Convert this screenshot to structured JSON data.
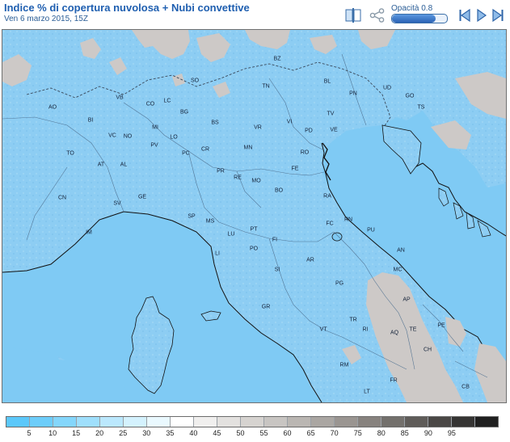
{
  "header": {
    "title": "Indice % di copertura nuvolosa + Nubi convettive",
    "subtitle": "Ven 6 marzo 2015, 15Z"
  },
  "toolbar": {
    "layers_icon": "layers-icon",
    "share_icon": "share-icon",
    "opacity_label": "Opacità 0.8",
    "opacity_value": 0.8,
    "nav_icons": [
      "first-frame-icon",
      "play-icon",
      "last-frame-icon"
    ]
  },
  "map": {
    "sea_color": "#7fcaf4",
    "cloud_color": "#8dcdf3",
    "mountain_color": "#cdc9c7",
    "border_color": "#4d6f8f",
    "coast_color": "#111111",
    "provinces": [
      "BZ",
      "SO",
      "TN",
      "BL",
      "UD",
      "PN",
      "GO",
      "VB",
      "CO",
      "LC",
      "BG",
      "BS",
      "VI",
      "TV",
      "TS",
      "AO",
      "BI",
      "MI",
      "VR",
      "PD",
      "VE",
      "VC",
      "NO",
      "LO",
      "TO",
      "PV",
      "PC",
      "CR",
      "MN",
      "RO",
      "AT",
      "AL",
      "PR",
      "RE",
      "MO",
      "FE",
      "CN",
      "GE",
      "BO",
      "RA",
      "SV",
      "SP",
      "MS",
      "FC",
      "RN",
      "PU",
      "IM",
      "LU",
      "PT",
      "FI",
      "AN",
      "LI",
      "PO",
      "AR",
      "SI",
      "MC",
      "PG",
      "GR",
      "TR",
      "VT",
      "RI",
      "AQ",
      "TE",
      "CH",
      "RM",
      "FR",
      "LT",
      "CB",
      "AP",
      "PE"
    ]
  },
  "legend": {
    "colors": [
      "#5cc8fa",
      "#6dcdfa",
      "#84d6fb",
      "#9fdffc",
      "#bbe8fd",
      "#d4f2fe",
      "#eaf9ff",
      "#ffffff",
      "#f0efee",
      "#e3e1df",
      "#d6d3d0",
      "#c8c5c2",
      "#bab6b2",
      "#aaa6a2",
      "#9a9591",
      "#87827e",
      "#73706c",
      "#5f5c59",
      "#4a4745",
      "#353433",
      "#1f1f1f"
    ],
    "labels": [
      "5",
      "10",
      "15",
      "20",
      "25",
      "30",
      "35",
      "40",
      "45",
      "50",
      "55",
      "60",
      "65",
      "70",
      "75",
      "80",
      "85",
      "90",
      "95"
    ]
  }
}
